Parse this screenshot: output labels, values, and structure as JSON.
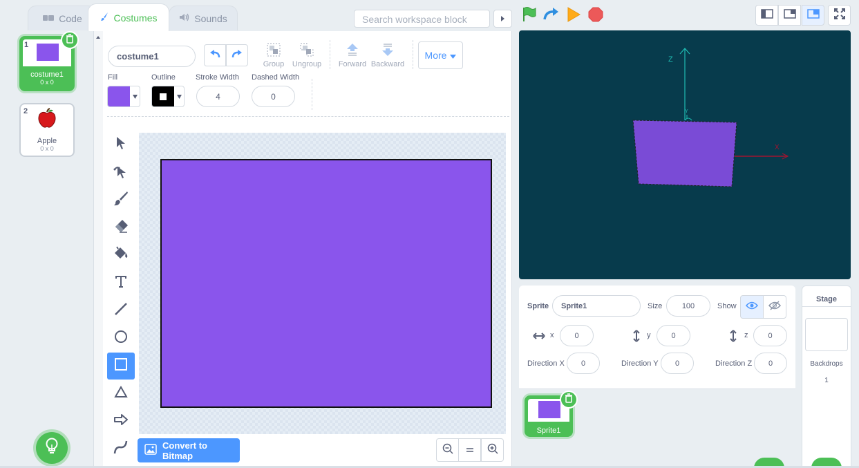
{
  "tabs": [
    {
      "label": "Code"
    },
    {
      "label": "Costumes"
    },
    {
      "label": "Sounds"
    }
  ],
  "search": {
    "placeholder": "Search workspace block"
  },
  "costumes": [
    {
      "number": "1",
      "name": "costume1",
      "size": "0 x 0",
      "selected": true
    },
    {
      "number": "2",
      "name": "Apple",
      "size": "0 x 0",
      "selected": false
    }
  ],
  "editor": {
    "costume_name": "costume1",
    "group_label": "Group",
    "ungroup_label": "Ungroup",
    "forward_label": "Forward",
    "backward_label": "Backward",
    "more_label": "More",
    "fill_label": "Fill",
    "outline_label": "Outline",
    "stroke_width_label": "Stroke Width",
    "stroke_width": "4",
    "dashed_width_label": "Dashed Width",
    "dashed_width": "0",
    "fill_color": "#8a55ec",
    "outline_color": "#000000",
    "convert_label": "Convert to Bitmap",
    "tools": [
      "select",
      "reshape",
      "brush",
      "eraser",
      "fill",
      "text",
      "line",
      "circle",
      "rectangle",
      "triangle",
      "arrow",
      "curve"
    ],
    "selected_tool": "rectangle"
  },
  "stage": {
    "axis_x": "X",
    "axis_y": "Y",
    "axis_z": "Z",
    "background": "#073b4c"
  },
  "sprite_info": {
    "sprite_label": "Sprite",
    "sprite_name": "Sprite1",
    "size_label": "Size",
    "size": "100",
    "show_label": "Show",
    "x_label": "x",
    "x": "0",
    "y_label": "y",
    "y": "0",
    "z_label": "z",
    "z": "0",
    "dir_x_label": "Direction X",
    "dir_x": "0",
    "dir_y_label": "Direction Y",
    "dir_y": "0",
    "dir_z_label": "Direction Z",
    "dir_z": "0"
  },
  "sprites": [
    {
      "name": "Sprite1"
    }
  ],
  "stage_panel": {
    "title": "Stage",
    "backdrops_label": "Backdrops",
    "backdrops_count": "1"
  },
  "colors": {
    "accent": "#4c97ff",
    "green": "#4cbf56",
    "purple": "#8a55ec"
  }
}
